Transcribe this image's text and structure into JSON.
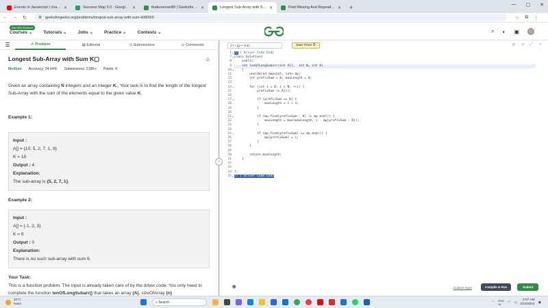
{
  "browser": {
    "tabs": [
      {
        "title": "Events in Javascript | chai aur Ja",
        "color": "#ff0000",
        "active": false
      },
      {
        "title": "Success Map 3.0 - Google Sheets",
        "color": "#1ea362",
        "active": false
      },
      {
        "title": "thakuraman89 | GeeksforGeeks",
        "color": "#2f8d46",
        "active": false
      },
      {
        "title": "Longest Sub-Array with Sum K",
        "color": "#2f8d46",
        "active": true
      },
      {
        "title": "Find Missing And Repeating | Pr",
        "color": "#2f8d46",
        "active": false
      }
    ],
    "url": "geeksforgeeks.org/problems/longest-sub-array-with-sum-k0809/0"
  },
  "site": {
    "badge": "Get 90% Refund!",
    "menu": [
      "Courses",
      "Tutorials",
      "Jobs",
      "Practice",
      "Contests"
    ],
    "logo": "GG"
  },
  "problem_tabs": [
    "Problem",
    "Editorial",
    "Submissions",
    "Comments"
  ],
  "problem": {
    "title": "Longest Sub-Array with Sum K",
    "difficulty": "Medium",
    "accuracy": "Accuracy: 24.64%",
    "submissions": "Submissions: 218K+",
    "points": "Points: 4",
    "desc_1": "Given an array containing ",
    "desc_n": "N",
    "desc_2": " integers and an integer ",
    "desc_k": "K",
    "desc_3": "., Your task is to find the length of the longest Sub-Array with the sum of the elements equal to the given value ",
    "desc_k2": "K",
    "desc_4": ".",
    "example1_title": "Example 1:",
    "example1": {
      "input_label": "Input :",
      "arr": "A[] = {10, 5, 2, 7, 1, 9}",
      "k": "K = 15",
      "output_label": "Output :",
      "output": " 4",
      "expl_label": "Explanation:",
      "expl": "The sub-array is ",
      "expl_b": "{5, 2, 7, 1}",
      "expl_end": "."
    },
    "example2_title": "Example 2:",
    "example2": {
      "input_label": "Input :",
      "arr": "A[] = {-1, 2, 3}",
      "k": "K = 6",
      "output_label": "Output :",
      "output": " 0",
      "expl_label": "Explanation:",
      "expl": "There is no such sub-array with sum 6."
    },
    "task_title": "Your Task:",
    "task_1": "This is a function problem. The input is already taken care of by the driver code. You only need to complete the function ",
    "task_fn": "lenOfLongSubarr()",
    "task_2": " that takes an array ",
    "task_a": "(A)",
    "task_3": ", sizeOfArray ",
    "task_n": "(n)"
  },
  "editor": {
    "language": "C++ (g++ 5.4)",
    "timer": "Start Timer ⏱",
    "lines": [
      {
        "n": "1",
        "fold": "▸",
        "pre": "",
        "sel": "//",
        "rest": " } Driver Code Ends",
        "style": "dim"
      },
      {
        "n": "7",
        "fold": "▾",
        "pre": "",
        "sel": "",
        "rest": "class Solution{",
        "style": ""
      },
      {
        "n": "8",
        "fold": "",
        "pre": "",
        "sel": "",
        "rest": "    public:",
        "style": "kw"
      },
      {
        "n": "9",
        "fold": "",
        "pre": "",
        "sel": "",
        "rest": "    int lenOfLongSubarr(int A[],  int N, int K)",
        "style": ""
      },
      {
        "n": "10",
        "fold": "▾",
        "pre": "",
        "sel": "",
        "rest": "    {",
        "style": ""
      },
      {
        "n": "11",
        "fold": "",
        "pre": "",
        "sel": "",
        "rest": "        unordered_map<int, int> mp;",
        "style": ""
      },
      {
        "n": "12",
        "fold": "",
        "pre": "",
        "sel": "",
        "rest": "        int prefixSum = 0, maxLength = 0;",
        "style": ""
      },
      {
        "n": "13",
        "fold": "",
        "pre": "",
        "sel": "",
        "rest": "",
        "style": ""
      },
      {
        "n": "14",
        "fold": "▾",
        "pre": "",
        "sel": "",
        "rest": "        for (int i = 0; i < N; ++i) {",
        "style": ""
      },
      {
        "n": "15",
        "fold": "",
        "pre": "",
        "sel": "",
        "rest": "            prefixSum += A[i];",
        "style": ""
      },
      {
        "n": "16",
        "fold": "",
        "pre": "",
        "sel": "",
        "rest": "",
        "style": ""
      },
      {
        "n": "17",
        "fold": "▾",
        "pre": "",
        "sel": "",
        "rest": "            if (prefixSum == K) {",
        "style": ""
      },
      {
        "n": "18",
        "fold": "",
        "pre": "",
        "sel": "",
        "rest": "                maxLength = i + 1;",
        "style": ""
      },
      {
        "n": "19",
        "fold": "",
        "pre": "",
        "sel": "",
        "rest": "            }",
        "style": ""
      },
      {
        "n": "20",
        "fold": "",
        "pre": "",
        "sel": "",
        "rest": "",
        "style": ""
      },
      {
        "n": "21",
        "fold": "▾",
        "pre": "",
        "sel": "",
        "rest": "            if (mp.find(prefixSum - K) != mp.end()) {",
        "style": ""
      },
      {
        "n": "22",
        "fold": "",
        "pre": "",
        "sel": "",
        "rest": "                maxLength = max(maxLength, i - mp[prefixSum - K]);",
        "style": ""
      },
      {
        "n": "23",
        "fold": "",
        "pre": "",
        "sel": "",
        "rest": "            }",
        "style": ""
      },
      {
        "n": "24",
        "fold": "",
        "pre": "",
        "sel": "",
        "rest": "",
        "style": ""
      },
      {
        "n": "25",
        "fold": "▾",
        "pre": "",
        "sel": "",
        "rest": "            if (mp.find(prefixSum) == mp.end()) {",
        "style": ""
      },
      {
        "n": "26",
        "fold": "",
        "pre": "",
        "sel": "",
        "rest": "                mp[prefixSum] = i;",
        "style": ""
      },
      {
        "n": "27",
        "fold": "",
        "pre": "",
        "sel": "",
        "rest": "            }",
        "style": ""
      },
      {
        "n": "28",
        "fold": "",
        "pre": "",
        "sel": "",
        "rest": "        }",
        "style": ""
      },
      {
        "n": "29",
        "fold": "",
        "pre": "",
        "sel": "",
        "rest": "",
        "style": ""
      },
      {
        "n": "30",
        "fold": "",
        "pre": "",
        "sel": "",
        "rest": "        return maxLength;",
        "style": ""
      },
      {
        "n": "31",
        "fold": "",
        "pre": "",
        "sel": "",
        "rest": "    }",
        "style": ""
      },
      {
        "n": "32",
        "fold": "",
        "pre": "",
        "sel": "",
        "rest": "",
        "style": ""
      },
      {
        "n": "33",
        "fold": "",
        "pre": "",
        "sel": "",
        "rest": "",
        "style": ""
      },
      {
        "n": "34",
        "fold": "",
        "pre": "",
        "sel": "",
        "rest": "};",
        "style": ""
      },
      {
        "n": "35",
        "fold": "▸",
        "pre": "",
        "sel": "//",
        "rest": " } Driver Code Ends",
        "style": "seltail"
      }
    ],
    "custom_input": "Custom Input",
    "compile_label": "Compile & Run",
    "submit_label": "Submit"
  },
  "taskbar": {
    "temp": "22°C",
    "weather": "Haze",
    "search": "Search",
    "time": "2:57 AM",
    "date": "3/23/2024",
    "lang": "ENG\nIN"
  }
}
